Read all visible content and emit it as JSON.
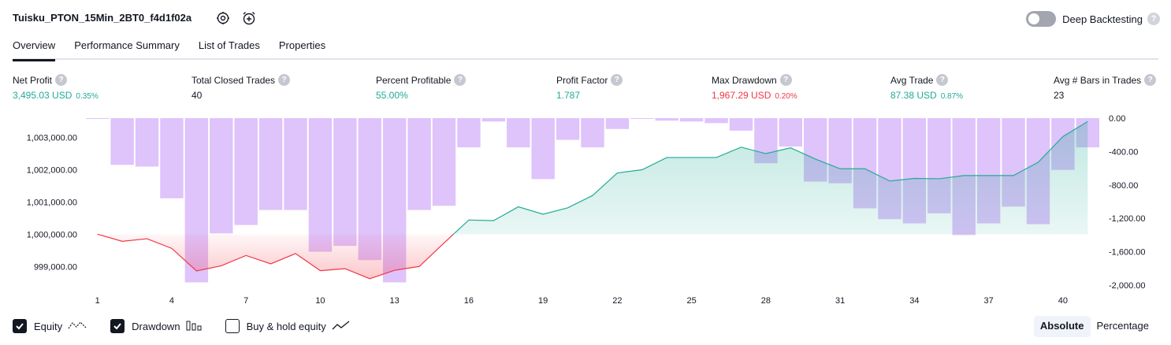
{
  "header": {
    "title": "Tuisku_PTON_15Min_2BT0_f4d1f02a",
    "settings_icon": "gear-icon",
    "add_alert_icon": "alarm-add-icon",
    "deep_backtesting_label": "Deep Backtesting",
    "deep_backtesting_on": false,
    "help_glyph": "?"
  },
  "tabs": [
    {
      "label": "Overview",
      "active": true
    },
    {
      "label": "Performance Summary",
      "active": false
    },
    {
      "label": "List of Trades",
      "active": false
    },
    {
      "label": "Properties",
      "active": false
    }
  ],
  "metrics": [
    {
      "title": "Net Profit",
      "value": "3,495.03 USD",
      "pct": "0.35%",
      "color": "green"
    },
    {
      "title": "Total Closed Trades",
      "value": "40",
      "pct": "",
      "color": "dark"
    },
    {
      "title": "Percent Profitable",
      "value": "55.00%",
      "pct": "",
      "color": "green"
    },
    {
      "title": "Profit Factor",
      "value": "1.787",
      "pct": "",
      "color": "green"
    },
    {
      "title": "Max Drawdown",
      "value": "1,967.29 USD",
      "pct": "0.20%",
      "color": "red"
    },
    {
      "title": "Avg Trade",
      "value": "87.38 USD",
      "pct": "0.87%",
      "color": "green"
    },
    {
      "title": "Avg # Bars in Trades",
      "value": "23",
      "pct": "",
      "color": "dark"
    }
  ],
  "colors": {
    "equity_up": "#22ab94",
    "equity_down": "#f23645",
    "drawdown_bar": "#d9b8fa",
    "accent_dark": "#131722"
  },
  "chart_data": {
    "type": "line",
    "series": [
      {
        "name": "Equity",
        "x": [
          1,
          2,
          3,
          4,
          5,
          6,
          7,
          8,
          9,
          10,
          11,
          12,
          13,
          14,
          15,
          16,
          17,
          18,
          19,
          20,
          21,
          22,
          23,
          24,
          25,
          26,
          27,
          28,
          29,
          30,
          31,
          32,
          33,
          34,
          35,
          36,
          37,
          38,
          39,
          40,
          41
        ],
        "values": [
          1000000,
          999780,
          999860,
          999560,
          998860,
          999020,
          999340,
          999080,
          999400,
          998870,
          998930,
          998620,
          998880,
          999000,
          999730,
          1000440,
          1000420,
          1000850,
          1000620,
          1000820,
          1001200,
          1001900,
          1002000,
          1002380,
          1002380,
          1002380,
          1002700,
          1002500,
          1002680,
          1002330,
          1002030,
          1002030,
          1001650,
          1001730,
          1001720,
          1001820,
          1001820,
          1001820,
          1002230,
          1003030,
          1003495
        ]
      },
      {
        "name": "Drawdown",
        "x": [
          1,
          2,
          3,
          4,
          5,
          6,
          7,
          8,
          9,
          10,
          11,
          12,
          13,
          14,
          15,
          16,
          17,
          18,
          19,
          20,
          21,
          22,
          23,
          24,
          25,
          26,
          27,
          28,
          29,
          30,
          31,
          32,
          33,
          34,
          35,
          36,
          37,
          38,
          39,
          40,
          41
        ],
        "values": [
          0,
          -560,
          -580,
          -960,
          -1967,
          -1380,
          -1280,
          -1100,
          -1100,
          -1600,
          -1530,
          -1700,
          -1967,
          -1100,
          -1050,
          -350,
          -40,
          -350,
          -730,
          -260,
          -350,
          -130,
          0,
          -30,
          -40,
          -60,
          -150,
          -540,
          -340,
          -760,
          -780,
          -1080,
          -1210,
          -1260,
          -1140,
          -1400,
          -1260,
          -1060,
          -1270,
          -620,
          -350
        ]
      }
    ],
    "x_ticks": [
      "1",
      "4",
      "7",
      "10",
      "13",
      "16",
      "19",
      "22",
      "25",
      "28",
      "31",
      "34",
      "37",
      "40"
    ],
    "left_axis": {
      "ticks": [
        "1,003,000.00",
        "1,002,000.00",
        "1,001,000.00",
        "1,000,000.00",
        "999,000.00"
      ],
      "ylim": [
        998420,
        1003600
      ]
    },
    "right_axis": {
      "ticks": [
        "0.00",
        "-400.00",
        "-800.00",
        "-1,200.00",
        "-1,600.00",
        "-2,000.00"
      ],
      "ylim": [
        -2000,
        0
      ]
    },
    "baseline": 1000000,
    "grid": false
  },
  "legend": [
    {
      "label": "Equity",
      "checked": true,
      "icon": "equity-line-icon"
    },
    {
      "label": "Drawdown",
      "checked": true,
      "icon": "drawdown-bars-icon"
    },
    {
      "label": "Buy & hold equity",
      "checked": false,
      "icon": "buy-hold-line-icon"
    }
  ],
  "mode": [
    {
      "label": "Absolute",
      "active": true
    },
    {
      "label": "Percentage",
      "active": false
    }
  ]
}
